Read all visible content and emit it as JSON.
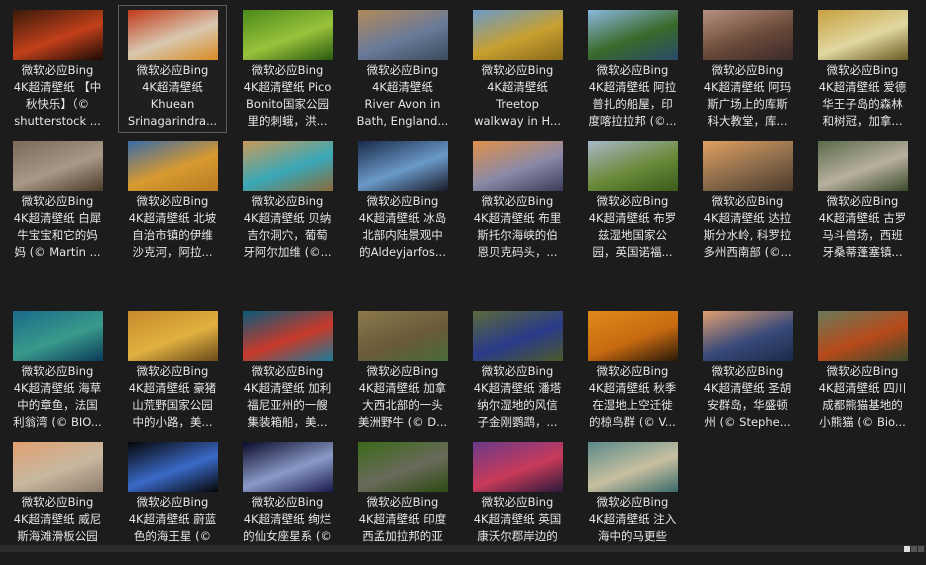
{
  "colors": {
    "background": "#1c1c1c",
    "text": "#e6e6e6",
    "selection_border": "#5c5c5c"
  },
  "selected_index": 1,
  "rows": [
    [
      {
        "label": "微软必应Bing\n4K超清壁纸 【中\n秋快乐】（©\nshutterstock ...",
        "thumb": [
          "#3a1a0a",
          "#c2401a",
          "#1a0a05"
        ]
      },
      {
        "label": "微软必应Bing\n4K超清壁纸\nKhuean\nSrinagarindra...",
        "thumb": [
          "#c23a1a",
          "#d8c8b0",
          "#d88a20"
        ]
      },
      {
        "label": "微软必应Bing\n4K超清壁纸 Pico\nBonito国家公园\n里的刺蛾，洪...",
        "thumb": [
          "#4a8a1a",
          "#9ac23a",
          "#2a5a10"
        ]
      },
      {
        "label": "微软必应Bing\n4K超清壁纸\nRiver Avon in\nBath, England...",
        "thumb": [
          "#b08a5a",
          "#6a7a9a",
          "#3a4a5a"
        ]
      },
      {
        "label": "微软必应Bing\n4K超清壁纸\nTreetop\nwalkway in H...",
        "thumb": [
          "#6a9ac8",
          "#c8a030",
          "#8a6a1a"
        ]
      },
      {
        "label": "微软必应Bing\n4K超清壁纸 阿拉\n普扎的船屋，印\n度喀拉拉邦 (©...",
        "thumb": [
          "#8ab8e0",
          "#3a6a2a",
          "#2a4a6a"
        ]
      },
      {
        "label": "微软必应Bing\n4K超清壁纸 阿玛\n斯广场上的库斯\n科大教堂，库...",
        "thumb": [
          "#b89080",
          "#6a4a3a",
          "#3a2a2a"
        ]
      },
      {
        "label": "微软必应Bing\n4K超清壁纸 爱德\n华王子岛的森林\n和树冠，加拿...",
        "thumb": [
          "#c8a040",
          "#e0d8a0",
          "#6a5a20"
        ]
      }
    ],
    [
      {
        "label": "微软必应Bing\n4K超清壁纸 白犀\n牛宝宝和它的妈\n妈 (© Martin ...",
        "thumb": [
          "#7a6a5a",
          "#a89888",
          "#4a3a2a"
        ]
      },
      {
        "label": "微软必应Bing\n4K超清壁纸 北坡\n自治市镇的伊维\n沙克河，阿拉...",
        "thumb": [
          "#3a6aa8",
          "#d89a30",
          "#b87a20"
        ]
      },
      {
        "label": "微软必应Bing\n4K超清壁纸 贝纳\n吉尔洞穴，葡萄\n牙阿尔加维 (©...",
        "thumb": [
          "#c89a5a",
          "#3aa8b8",
          "#8a6a3a"
        ]
      },
      {
        "label": "微软必应Bing\n4K超清壁纸 冰岛\n北部内陆景观中\n的Aldeyjarfos...",
        "thumb": [
          "#1a2a4a",
          "#6a9ac8",
          "#1a1a2a"
        ]
      },
      {
        "label": "微软必应Bing\n4K超清壁纸 布里\n斯托尔海峡的伯\n恩贝克码头，...",
        "thumb": [
          "#e0904a",
          "#8a8aa8",
          "#3a3a5a"
        ]
      },
      {
        "label": "微软必应Bing\n4K超清壁纸 布罗\n兹湿地国家公\n园，英国诺福...",
        "thumb": [
          "#a8b8c8",
          "#6a8a3a",
          "#3a5a1a"
        ]
      },
      {
        "label": "微软必应Bing\n4K超清壁纸 达拉\n斯分水岭, 科罗拉\n多州西南部 (©...",
        "thumb": [
          "#e0a060",
          "#8a6a4a",
          "#4a3a2a"
        ]
      },
      {
        "label": "微软必应Bing\n4K超清壁纸 古罗\n马斗兽场，西班\n牙桑蒂蓬塞镇...",
        "thumb": [
          "#5a6a4a",
          "#b8b0a0",
          "#3a4a2a"
        ]
      }
    ],
    [
      {
        "label": "微软必应Bing\n4K超清壁纸 海草\n中的章鱼，法国\n利翁湾 (© BIO...",
        "thumb": [
          "#1a6a8a",
          "#3a9a8a",
          "#0a3a5a"
        ]
      },
      {
        "label": "微软必应Bing\n4K超清壁纸 豪猪\n山荒野国家公园\n中的小路，美...",
        "thumb": [
          "#c88a2a",
          "#e0b040",
          "#6a4a1a"
        ]
      },
      {
        "label": "微软必应Bing\n4K超清壁纸 加利\n福尼亚州的一艘\n集装箱船，美...",
        "thumb": [
          "#0a5a7a",
          "#c83a2a",
          "#1a7a9a"
        ]
      },
      {
        "label": "微软必应Bing\n4K超清壁纸 加拿\n大西北部的一头\n美洲野牛 (© D...",
        "thumb": [
          "#8a7a4a",
          "#6a5a3a",
          "#4a6a3a"
        ]
      },
      {
        "label": "微软必应Bing\n4K超清壁纸 潘塔\n纳尔湿地的风信\n子金刚鹦鹉，...",
        "thumb": [
          "#5a6a3a",
          "#2a3a8a",
          "#4a5a2a"
        ]
      },
      {
        "label": "微软必应Bing\n4K超清壁纸 秋季\n在湿地上空迁徙\n的椋鸟群 (© V...",
        "thumb": [
          "#e08a1a",
          "#c86a10",
          "#2a1a0a"
        ]
      },
      {
        "label": "微软必应Bing\n4K超清壁纸 圣胡\n安群岛，华盛顿\n州 (© Stephe...",
        "thumb": [
          "#e0a070",
          "#3a4a7a",
          "#1a2a4a"
        ]
      },
      {
        "label": "微软必应Bing\n4K超清壁纸 四川\n成都熊猫基地的\n小熊猫 (© Bio...",
        "thumb": [
          "#6a7a5a",
          "#b84a1a",
          "#3a4a2a"
        ]
      }
    ],
    [
      {
        "label": "微软必应Bing\n4K超清壁纸 威尼\n斯海滩滑板公园",
        "thumb": [
          "#e0a070",
          "#c8b8a0",
          "#8a7a6a"
        ]
      },
      {
        "label": "微软必应Bing\n4K超清壁纸 蔚蓝\n色的海王星 (©",
        "thumb": [
          "#050505",
          "#3a6ac8",
          "#050505"
        ]
      },
      {
        "label": "微软必应Bing\n4K超清壁纸 绚烂\n的仙女座星系 (©",
        "thumb": [
          "#0a0a2a",
          "#8a9ac8",
          "#1a1a4a"
        ]
      },
      {
        "label": "微软必应Bing\n4K超清壁纸 印度\n西孟加拉邦的亚",
        "thumb": [
          "#3a6a1a",
          "#6a6a5a",
          "#2a4a10"
        ]
      },
      {
        "label": "微软必应Bing\n4K超清壁纸 英国\n康沃尔郡岸边的",
        "thumb": [
          "#6a3a8a",
          "#c83a5a",
          "#2a1a3a"
        ]
      },
      {
        "label": "微软必应Bing\n4K超清壁纸 注入\n海中的马更些",
        "thumb": [
          "#5a8a8a",
          "#c8c0a0",
          "#3a6a6a"
        ]
      }
    ]
  ]
}
